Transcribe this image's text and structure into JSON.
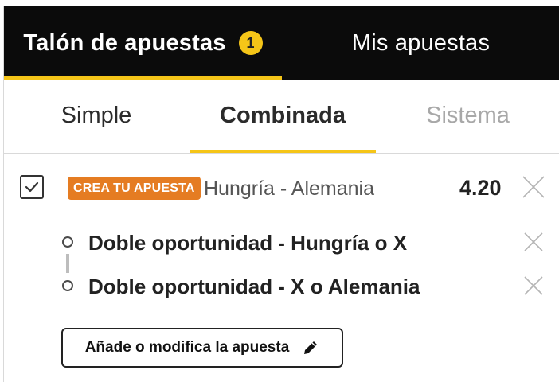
{
  "header": {
    "tabs": [
      {
        "label": "Talón de apuestas",
        "badge": "1",
        "active": true
      },
      {
        "label": "Mis apuestas",
        "active": false
      }
    ],
    "accent_color": "#f5c518",
    "background_color": "#0b0b0b"
  },
  "subtabs": [
    {
      "label": "Simple",
      "active": false
    },
    {
      "label": "Combinada",
      "active": true
    },
    {
      "label": "Sistema",
      "active": false,
      "disabled": true
    }
  ],
  "bet": {
    "checked": true,
    "tag": "CREA TU APUESTA",
    "tag_color": "#e57c22",
    "match": "Hungría - Alemania",
    "odds": "4.20",
    "selections": [
      {
        "label": "Doble oportunidad - Hungría o X"
      },
      {
        "label": "Doble oportunidad - X o Alemania"
      }
    ],
    "modify_button": {
      "label": "Añade o modifica la apuesta",
      "icon": "pencil-icon"
    }
  }
}
